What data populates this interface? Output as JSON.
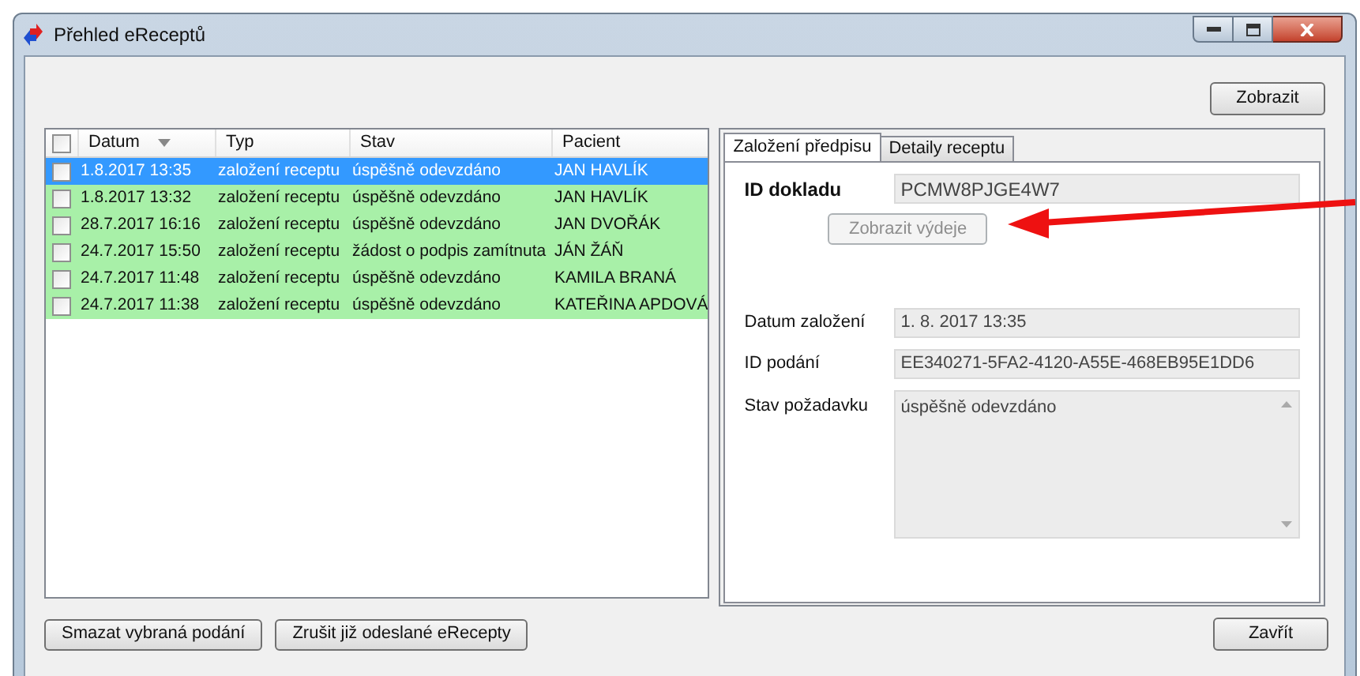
{
  "window": {
    "title": "Přehled eReceptů"
  },
  "toolbar": {
    "show_button": "Zobrazit"
  },
  "table": {
    "select_all": {
      "checked": false
    },
    "columns": [
      {
        "label": "Datum",
        "sorted": true
      },
      {
        "label": "Typ",
        "sorted": false
      },
      {
        "label": "Stav",
        "sorted": false
      },
      {
        "label": "Pacient",
        "sorted": false
      }
    ],
    "rows": [
      {
        "selected": true,
        "checked": false,
        "cells": [
          "1.8.2017 13:35",
          "založení receptu",
          "úspěšně odevzdáno",
          "JAN HAVLÍK"
        ]
      },
      {
        "selected": false,
        "checked": false,
        "cells": [
          "1.8.2017 13:32",
          "založení receptu",
          "úspěšně odevzdáno",
          "JAN HAVLÍK"
        ]
      },
      {
        "selected": false,
        "checked": false,
        "cells": [
          "28.7.2017 16:16",
          "založení receptu",
          "úspěšně odevzdáno",
          "JAN DVOŘÁK"
        ]
      },
      {
        "selected": false,
        "checked": false,
        "cells": [
          "24.7.2017 15:50",
          "založení receptu",
          "žádost o podpis zamítnuta",
          "JÁN ŽÁŇ"
        ]
      },
      {
        "selected": false,
        "checked": false,
        "cells": [
          "24.7.2017 11:48",
          "založení receptu",
          "úspěšně odevzdáno",
          "KAMILA BRANÁ"
        ]
      },
      {
        "selected": false,
        "checked": false,
        "cells": [
          "24.7.2017 11:38",
          "založení receptu",
          "úspěšně odevzdáno",
          "KATEŘINA APDOVÁ"
        ]
      }
    ]
  },
  "tabs": [
    {
      "label": "Založení předpisu",
      "selected": true
    },
    {
      "label": "Detaily receptu",
      "selected": false
    }
  ],
  "details": {
    "document_id": {
      "label": "ID dokladu",
      "value": "PCMW8PJGE4W7"
    },
    "show_dispensing_button": {
      "label": "Zobrazit výdeje",
      "disabled": true
    },
    "fields": [
      {
        "label": "Datum založení",
        "value": "1. 8. 2017 13:35"
      },
      {
        "label": "ID podání",
        "value": "EE340271-5FA2-4120-A55E-468EB95E1DD6"
      }
    ],
    "request_state": {
      "label": "Stav požadavku",
      "value": "úspěšně odevzdáno"
    }
  },
  "footer": {
    "buttons": [
      "Smazat vybraná podání",
      "Zrušit již odeslané eRecepty"
    ],
    "close_button": "Zavřít"
  }
}
